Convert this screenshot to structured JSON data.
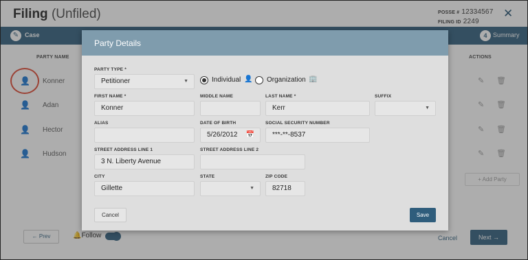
{
  "header": {
    "title": "Filing",
    "subtitle": "(Unfiled)",
    "posse_label": "POSSE #",
    "posse_value": "12334567",
    "filing_id_label": "FILING ID",
    "filing_id_value": "2249"
  },
  "steps": {
    "first_label": "Case",
    "last_number": "4",
    "last_label": "Summary"
  },
  "table": {
    "col_party_name": "PARTY NAME",
    "col_actions": "ACTIONS",
    "rows": [
      {
        "name": "Konner"
      },
      {
        "name": "Adan"
      },
      {
        "name": "Hector"
      },
      {
        "name": "Hudson"
      }
    ],
    "add_party_label": "Add Party"
  },
  "footer": {
    "prev_label": "Prev",
    "follow_label": "Follow",
    "cancel_label": "Cancel",
    "next_label": "Next"
  },
  "modal": {
    "title": "Party Details",
    "party_type": {
      "label": "PARTY TYPE *",
      "value": "Petitioner"
    },
    "radio_individual": "Individual",
    "radio_organization": "Organization",
    "radio_selected": "Individual",
    "first_name": {
      "label": "FIRST NAME *",
      "value": "Konner"
    },
    "middle_name": {
      "label": "MIDDLE NAME",
      "value": ""
    },
    "last_name": {
      "label": "LAST NAME *",
      "value": "Kerr"
    },
    "suffix": {
      "label": "SUFFIX",
      "value": ""
    },
    "alias": {
      "label": "ALIAS",
      "value": ""
    },
    "dob": {
      "label": "DATE OF BIRTH",
      "value": "5/26/2012"
    },
    "ssn": {
      "label": "SOCIAL SECURITY NUMBER",
      "value": "***-**-8537"
    },
    "addr1": {
      "label": "STREET ADDRESS LINE 1",
      "value": "3 N. Liberty Avenue"
    },
    "addr2": {
      "label": "STREET ADDRESS LINE 2",
      "value": ""
    },
    "city": {
      "label": "CITY",
      "value": "Gillette"
    },
    "state": {
      "label": "STATE",
      "value": ""
    },
    "zip": {
      "label": "ZIP CODE",
      "value": "82718"
    },
    "cancel_label": "Cancel",
    "save_label": "Save"
  },
  "colors": {
    "brand": "#2f5d7c",
    "modal_header": "#7f9cad",
    "highlight": "#e0452f"
  }
}
